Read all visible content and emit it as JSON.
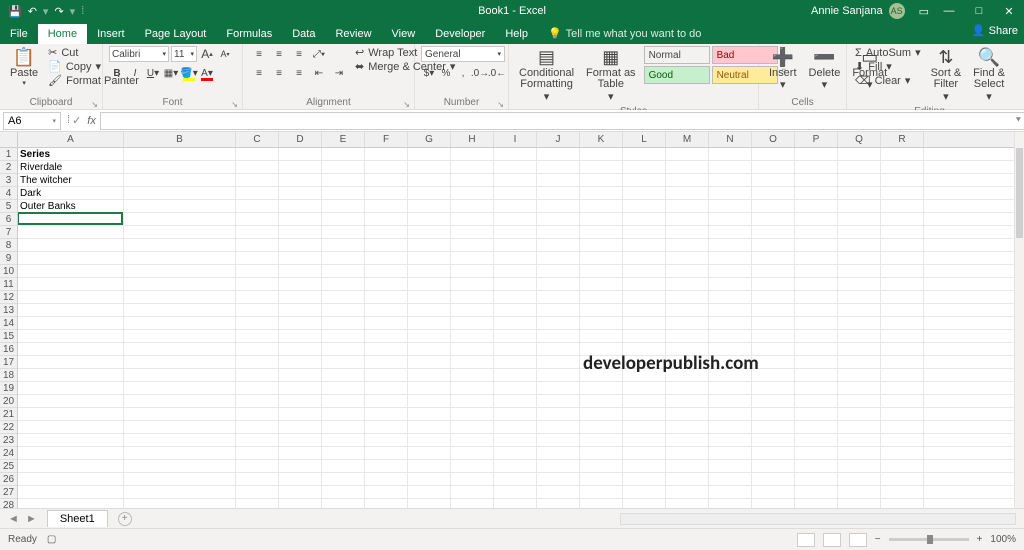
{
  "title": "Book1 - Excel",
  "user": {
    "name": "Annie Sanjana",
    "initials": "AS"
  },
  "qat": {
    "save": "💾",
    "undo": "↶",
    "redo": "↷"
  },
  "tabs": [
    "File",
    "Home",
    "Insert",
    "Page Layout",
    "Formulas",
    "Data",
    "Review",
    "View",
    "Developer",
    "Help"
  ],
  "active_tab": "Home",
  "tell_me": "Tell me what you want to do",
  "share": "Share",
  "ribbon": {
    "clipboard": {
      "label": "Clipboard",
      "paste": "Paste",
      "cut": "Cut",
      "copy": "Copy",
      "fmtpainter": "Format Painter"
    },
    "font": {
      "label": "Font",
      "name": "Calibri",
      "size": "11",
      "grow": "A",
      "shrink": "A"
    },
    "alignment": {
      "label": "Alignment",
      "wrap": "Wrap Text",
      "merge": "Merge & Center"
    },
    "number": {
      "label": "Number",
      "format": "General"
    },
    "styles": {
      "label": "Styles",
      "cond": "Conditional\nFormatting",
      "table": "Format as\nTable",
      "normal": "Normal",
      "bad": "Bad",
      "good": "Good",
      "neutral": "Neutral"
    },
    "cells": {
      "label": "Cells",
      "insert": "Insert",
      "delete": "Delete",
      "format": "Format"
    },
    "editing": {
      "label": "Editing",
      "autosum": "AutoSum",
      "fill": "Fill",
      "clear": "Clear",
      "sort": "Sort &\nFilter",
      "find": "Find &\nSelect"
    }
  },
  "namebox": "A6",
  "columns": [
    "A",
    "B",
    "C",
    "D",
    "E",
    "F",
    "G",
    "H",
    "I",
    "J",
    "K",
    "L",
    "M",
    "N",
    "O",
    "P",
    "Q",
    "R"
  ],
  "row_max": 29,
  "data": {
    "1": {
      "A": "Series"
    },
    "2": {
      "A": "Riverdale"
    },
    "3": {
      "A": "The witcher"
    },
    "4": {
      "A": "Dark"
    },
    "5": {
      "A": "Outer Banks"
    }
  },
  "selected": {
    "row": 6,
    "col": "A"
  },
  "watermark": "developerpublish.com",
  "sheet_tab": "Sheet1",
  "status": {
    "ready": "Ready",
    "zoom": "100%"
  }
}
